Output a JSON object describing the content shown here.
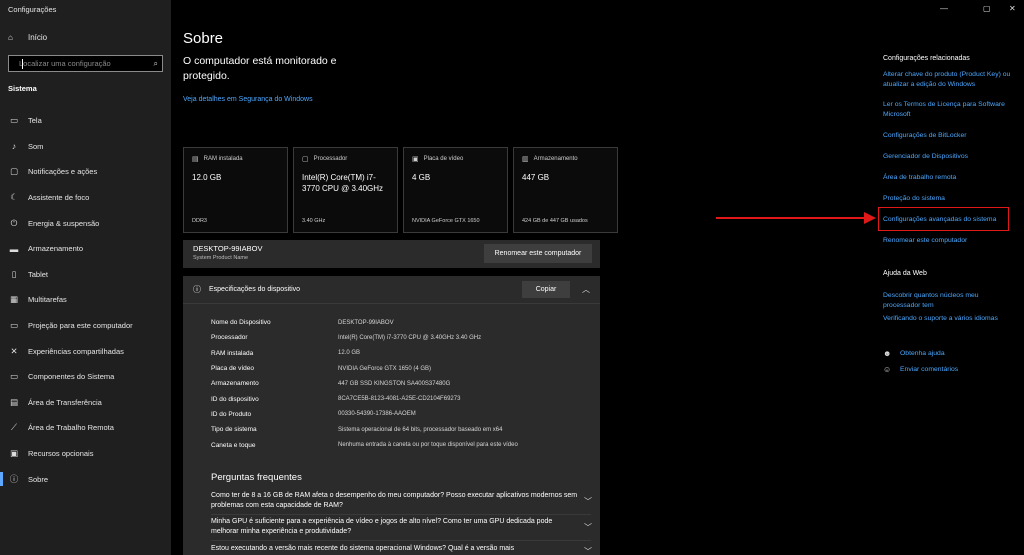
{
  "window": {
    "title": "Configurações",
    "min": "—",
    "max": "▢",
    "close": "✕"
  },
  "sidebar": {
    "home": "Início",
    "search_placeholder": "Localizar uma configuração",
    "section": "Sistema",
    "items": [
      {
        "label": "Tela",
        "icon": "▭"
      },
      {
        "label": "Som",
        "icon": "♪"
      },
      {
        "label": "Notificações e ações",
        "icon": "▢"
      },
      {
        "label": "Assistente de foco",
        "icon": "☾"
      },
      {
        "label": "Energia & suspensão",
        "icon": "⏻"
      },
      {
        "label": "Armazenamento",
        "icon": "▬"
      },
      {
        "label": "Tablet",
        "icon": "▯"
      },
      {
        "label": "Multitarefas",
        "icon": "▦"
      },
      {
        "label": "Projeção para este computador",
        "icon": "▭"
      },
      {
        "label": "Experiências compartilhadas",
        "icon": "✕"
      },
      {
        "label": "Componentes do Sistema",
        "icon": "▭"
      },
      {
        "label": "Área de Transferência",
        "icon": "▤"
      },
      {
        "label": "Área de Trabalho Remota",
        "icon": "⟋"
      },
      {
        "label": "Recursos opcionais",
        "icon": "▣"
      },
      {
        "label": "Sobre",
        "icon": "ⓘ"
      }
    ]
  },
  "main": {
    "title": "Sobre",
    "monitor_text": "O computador está monitorado e protegido.",
    "security_link": "Veja detalhes em Segurança do Windows",
    "cards": [
      {
        "head": "RAM instalada",
        "value": "12.0 GB",
        "sub": "DDR3",
        "icon": "▤"
      },
      {
        "head": "Processador",
        "value": "Intel(R) Core(TM) i7-3770 CPU @ 3.40GHz",
        "sub": "3.40 GHz",
        "icon": "▢"
      },
      {
        "head": "Placa de vídeo",
        "value": "4 GB",
        "sub": "NVIDIA GeForce GTX 1650",
        "icon": "▣"
      },
      {
        "head": "Armazenamento",
        "value": "447 GB",
        "sub": "424 GB de 447 GB usados",
        "icon": "▥"
      }
    ],
    "device_name": "DESKTOP-99IABOV",
    "device_sub": "System Product Name",
    "rename_button": "Renomear este computador",
    "spec_title": "Especificações do dispositivo",
    "copy_button": "Copiar",
    "specs": [
      {
        "k": "Nome do Dispositivo",
        "v": "DESKTOP-99IABOV"
      },
      {
        "k": "Processador",
        "v": "Intel(R) Core(TM) i7-3770 CPU @ 3.40GHz   3.40 GHz"
      },
      {
        "k": "RAM instalada",
        "v": "12.0 GB"
      },
      {
        "k": "Placa de vídeo",
        "v": "NVIDIA GeForce GTX 1650 (4 GB)"
      },
      {
        "k": "Armazenamento",
        "v": "447 GB SSD KINGSTON SA400S37480G"
      },
      {
        "k": "ID do dispositivo",
        "v": "8CA7CE5B-8123-4081-A25E-CD2104F69273"
      },
      {
        "k": "ID do Produto",
        "v": "00330-54390-17386-AAOEM"
      },
      {
        "k": "Tipo de sistema",
        "v": "Sistema operacional de 64 bits, processador baseado em x64"
      },
      {
        "k": "Caneta e toque",
        "v": "Nenhuma entrada à caneta ou por toque disponível para este vídeo"
      }
    ],
    "faq_title": "Perguntas frequentes",
    "faqs": [
      "Como ter de 8 a 16 GB de RAM afeta o desempenho do meu computador? Posso executar aplicativos modernos sem problemas com esta capacidade de RAM?",
      "Minha GPU é suficiente para a experiência de vídeo e jogos de alto nível? Como ter uma GPU dedicada pode melhorar minha experiência e produtividade?",
      "Estou executando a versão mais recente do sistema operacional Windows? Qual é a versão mais"
    ]
  },
  "related": {
    "title": "Configurações relacionadas",
    "links": [
      "Alterar chave do produto (Product Key) ou atualizar a edição do Windows",
      "Ler os Termos de Licença para Software Microsoft",
      "Configurações de BitLocker",
      "Gerenciador de Dispositivos",
      "Área de trabalho remota",
      "Proteção do sistema",
      "Configurações avançadas do sistema",
      "Renomear este computador"
    ],
    "web_title": "Ajuda da Web",
    "web_links": [
      "Descobrir quantos núcleos meu processador tem",
      "Verificando o suporte a vários idiomas"
    ],
    "help": "Obtenha ajuda",
    "feedback": "Enviar comentários"
  },
  "colors": {
    "accent": "#4ca8ff",
    "highlight": "#e01818",
    "sidebar": "#1f1f1f",
    "panel": "#2b2b2b"
  }
}
